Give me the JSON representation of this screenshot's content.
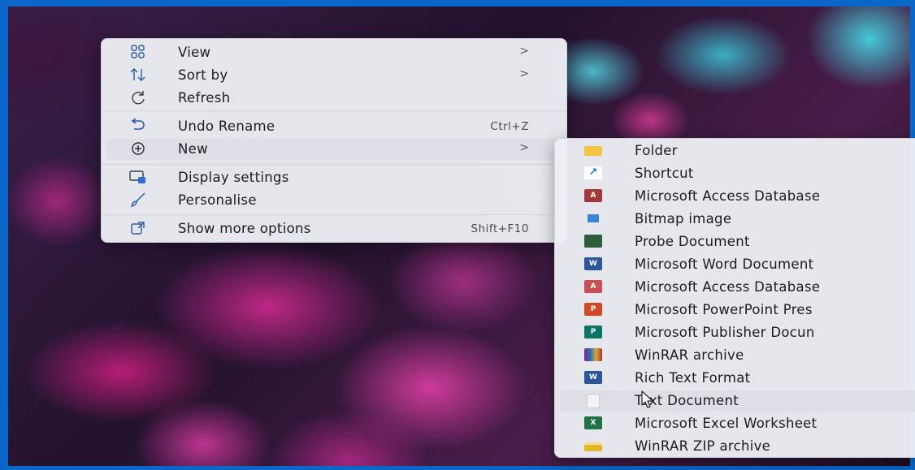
{
  "context_menu": {
    "items": [
      {
        "label": "View",
        "icon": "grid-icon",
        "has_submenu": true
      },
      {
        "label": "Sort by",
        "icon": "sort-icon",
        "has_submenu": true
      },
      {
        "label": "Refresh",
        "icon": "refresh-icon",
        "has_submenu": false
      },
      {
        "label": "Undo Rename",
        "icon": "undo-icon",
        "shortcut": "Ctrl+Z"
      },
      {
        "label": "New",
        "icon": "plus-circle-icon",
        "has_submenu": true,
        "highlighted": true
      },
      {
        "label": "Display settings",
        "icon": "display-icon"
      },
      {
        "label": "Personalise",
        "icon": "brush-icon"
      },
      {
        "label": "Show more options",
        "icon": "external-icon",
        "shortcut": "Shift+F10"
      }
    ],
    "submenu_arrow": ">"
  },
  "new_submenu": {
    "items": [
      {
        "label": "Folder",
        "icon": "folder-icon",
        "color": "#f4c542"
      },
      {
        "label": "Shortcut",
        "icon": "shortcut-icon",
        "color": "#1f6fd1"
      },
      {
        "label": "Microsoft Access Database",
        "icon": "access-icon",
        "color": "#a4373a"
      },
      {
        "label": "Bitmap image",
        "icon": "bitmap-icon",
        "color": "#3a86d6"
      },
      {
        "label": "Probe Document",
        "icon": "probe-icon",
        "color": "#2e5e3a"
      },
      {
        "label": "Microsoft Word Document",
        "icon": "word-icon",
        "color": "#2b579a"
      },
      {
        "label": "Microsoft Access Database",
        "icon": "access-icon",
        "color": "#c94f55"
      },
      {
        "label": "Microsoft PowerPoint Pres",
        "icon": "powerpoint-icon",
        "color": "#d24726"
      },
      {
        "label": "Microsoft Publisher Docun",
        "icon": "publisher-icon",
        "color": "#077568"
      },
      {
        "label": "WinRAR archive",
        "icon": "winrar-icon",
        "color": "#7a2a8a"
      },
      {
        "label": "Rich Text Format",
        "icon": "rtf-icon",
        "color": "#2b579a"
      },
      {
        "label": "Text Document",
        "icon": "text-document-icon",
        "color": "#c9ccd1",
        "highlighted": true
      },
      {
        "label": "Microsoft Excel Worksheet",
        "icon": "excel-icon",
        "color": "#217346"
      },
      {
        "label": "WinRAR ZIP archive",
        "icon": "zip-icon",
        "color": "#e2b72b"
      }
    ]
  }
}
